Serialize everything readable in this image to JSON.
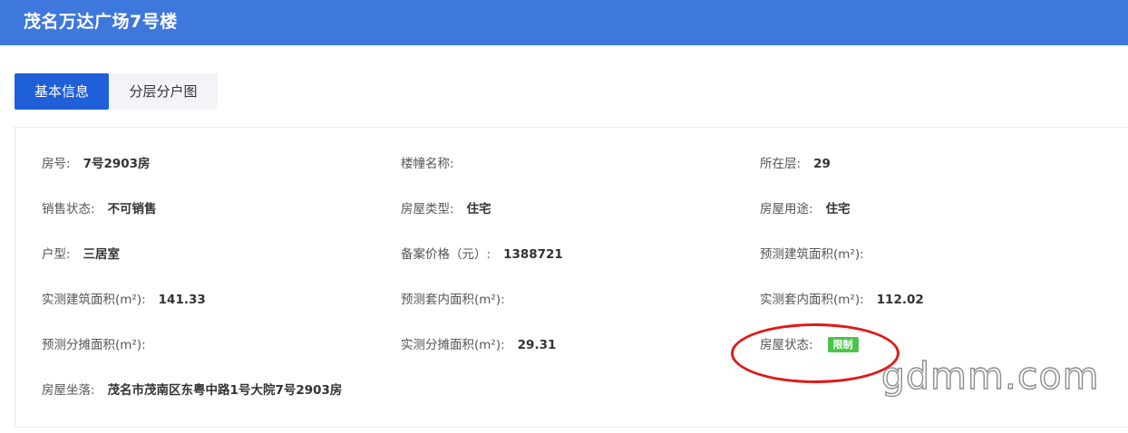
{
  "header": {
    "title": "茂名万达广场7号楼"
  },
  "tabs": [
    {
      "label": "基本信息"
    },
    {
      "label": "分层分户图"
    }
  ],
  "fields": {
    "room_no": {
      "label": "房号:",
      "value": "7号2903房"
    },
    "building_name": {
      "label": "楼幢名称:",
      "value": ""
    },
    "floor": {
      "label": "所在层:",
      "value": "29"
    },
    "sale_status": {
      "label": "销售状态:",
      "value": "不可销售"
    },
    "house_type": {
      "label": "房屋类型:",
      "value": "住宅"
    },
    "house_use": {
      "label": "房屋用途:",
      "value": "住宅"
    },
    "layout": {
      "label": "户型:",
      "value": "三居室"
    },
    "filing_price": {
      "label": "备案价格（元）:",
      "value": "1388721"
    },
    "est_build_area": {
      "label": "预测建筑面积(m²):",
      "value": ""
    },
    "act_build_area": {
      "label": "实测建筑面积(m²):",
      "value": "141.33"
    },
    "est_inner_area": {
      "label": "预测套内面积(m²):",
      "value": ""
    },
    "act_inner_area": {
      "label": "实测套内面积(m²):",
      "value": "112.02"
    },
    "est_shared_area": {
      "label": "预测分摊面积(m²):",
      "value": ""
    },
    "act_shared_area": {
      "label": "实测分摊面积(m²):",
      "value": "29.31"
    },
    "house_status": {
      "label": "房屋状态:",
      "value": "限制"
    },
    "address": {
      "label": "房屋坐落:",
      "value": "茂名市茂南区东粤中路1号大院7号2903房"
    }
  },
  "colors": {
    "header_bg": "#3f78dc",
    "active_tab": "#1f5fd8",
    "badge_green": "#4cc34c",
    "annotation_red": "#e01818"
  },
  "watermark": {
    "text": "gdmm.com"
  }
}
